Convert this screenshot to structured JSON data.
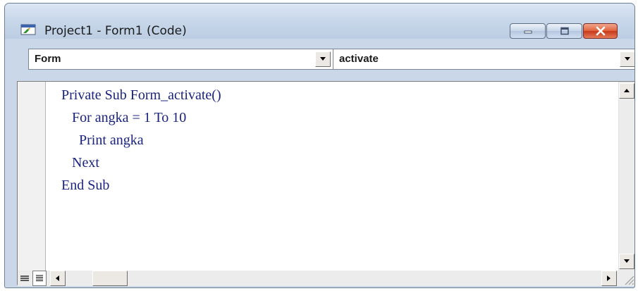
{
  "window": {
    "title": "Project1 - Form1 (Code)",
    "app_icon": "vb-form-icon",
    "controls": [
      "minimize-icon",
      "maximize-icon",
      "close-icon"
    ]
  },
  "object_combo": {
    "value": "Form"
  },
  "procedure_combo": {
    "value": "activate"
  },
  "code": {
    "lines": [
      "Private Sub Form_activate()",
      "   For angka = 1 To 10",
      "     Print angka",
      "   Next",
      "End Sub"
    ],
    "text_color": "#1a237e"
  },
  "bottom_bar": {
    "view_buttons": [
      "procedure-view-icon",
      "full-module-view-icon"
    ]
  }
}
